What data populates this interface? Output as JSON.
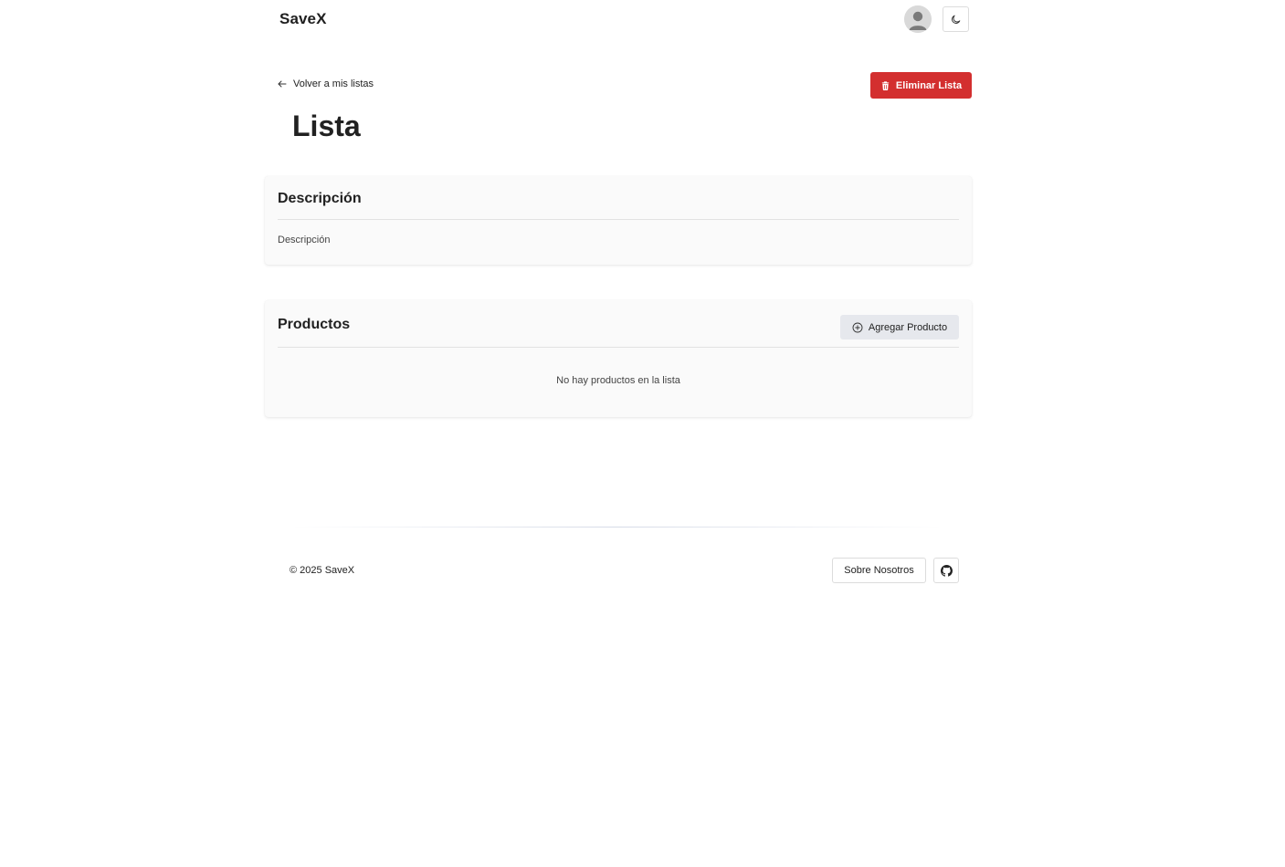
{
  "header": {
    "brand": "SaveX",
    "avatar_icon": "account-circle-icon",
    "theme_toggle_icon": "moon-icon"
  },
  "actions": {
    "back_label": "Volver a mis listas",
    "back_icon": "arrow-left-icon",
    "delete_label": "Eliminar Lista",
    "delete_icon": "trash-icon",
    "delete_color": "#d32f2f"
  },
  "page": {
    "title": "Lista"
  },
  "description_card": {
    "title": "Descripción",
    "text": "Descripción"
  },
  "products_card": {
    "title": "Productos",
    "add_label": "Agregar Producto",
    "add_icon": "plus-circle-icon",
    "empty_text": "No hay productos en la lista"
  },
  "footer": {
    "copyright": "© 2025 SaveX",
    "about_label": "Sobre Nosotros",
    "github_icon": "github-icon"
  }
}
